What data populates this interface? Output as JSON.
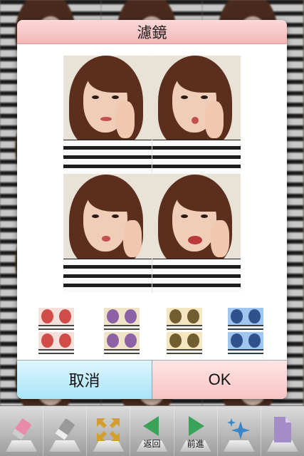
{
  "dialog": {
    "title": "濾鏡",
    "cancel_label": "取消",
    "ok_label": "OK",
    "filters": [
      {
        "name": "red",
        "tint": "#c8322c"
      },
      {
        "name": "purple",
        "tint": "#7a4aa0"
      },
      {
        "name": "sepia",
        "tint": "#8a6a30"
      },
      {
        "name": "blue",
        "tint": "#2a64b8"
      }
    ]
  },
  "toolbar": {
    "items": [
      {
        "icon": "pencil-eraser-icon",
        "label": ""
      },
      {
        "icon": "eraser-icon",
        "label": ""
      },
      {
        "icon": "expand-arrows-icon",
        "label": ""
      },
      {
        "icon": "back-arrow-icon",
        "label": "返回"
      },
      {
        "icon": "forward-arrow-icon",
        "label": "前進"
      },
      {
        "icon": "sparkle-icon",
        "label": ""
      },
      {
        "icon": "document-icon",
        "label": ""
      }
    ]
  },
  "colors": {
    "title_bar": "#f4b7b7",
    "cancel_bg": "#a9e4f7",
    "ok_bg": "#f8c3c3",
    "toolbar_green": "#3aa35a",
    "toolbar_purple": "#a48cc8",
    "toolbar_gold": "#d2a02a"
  }
}
